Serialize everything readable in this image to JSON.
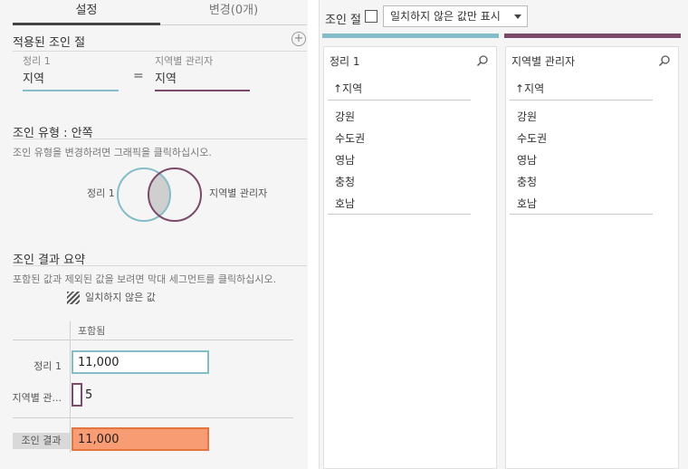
{
  "tabs": {
    "settings": "설정",
    "changes": "변경(0개)"
  },
  "applied_join": {
    "title": "적용된 조인 절",
    "plus_label": "+",
    "left_table": "정리 1",
    "right_table": "지역별 관리자",
    "left_field": "지역",
    "operator": "=",
    "right_field": "지역"
  },
  "join_type": {
    "title": "조인 유형 : 안쪽",
    "hint": "조인 유형을 변경하려면 그래픽을 클릭하십시오.",
    "left_label": "정리 1",
    "right_label": "지역별 관리자"
  },
  "summary": {
    "title": "조인 결과 요약",
    "hint": "포함된 값과 제외된 값을 보려면 막대 세그먼트를 클릭하십시오.",
    "legend": "일치하지 않은 값",
    "column_header": "포함됨",
    "rows": [
      {
        "label": "정리 1",
        "value": "11,000"
      },
      {
        "label": "지역별 관...",
        "value": "5"
      }
    ],
    "result_label": "조인 결과",
    "result_value": "11,000"
  },
  "join_clause_bar": {
    "label": "조인 절",
    "dropdown_value": "일치하지 않은 값만 표시"
  },
  "panels": [
    {
      "title": "정리 1",
      "sort_header": "↑지역",
      "items": [
        "강원",
        "수도권",
        "영남",
        "충청",
        "호남"
      ]
    },
    {
      "title": "지역별 관리자",
      "sort_header": "↑지역",
      "items": [
        "강원",
        "수도권",
        "영남",
        "충청",
        "호남"
      ]
    }
  ],
  "colors": {
    "left_table": "#84bdc8",
    "right_table": "#7b4a6b",
    "result": "#f89c74"
  },
  "icons": {
    "plus": "plus-circle-icon",
    "search": "search-icon",
    "hatch": "hatch-pattern-icon",
    "dropdown": "chevron-down-icon"
  }
}
